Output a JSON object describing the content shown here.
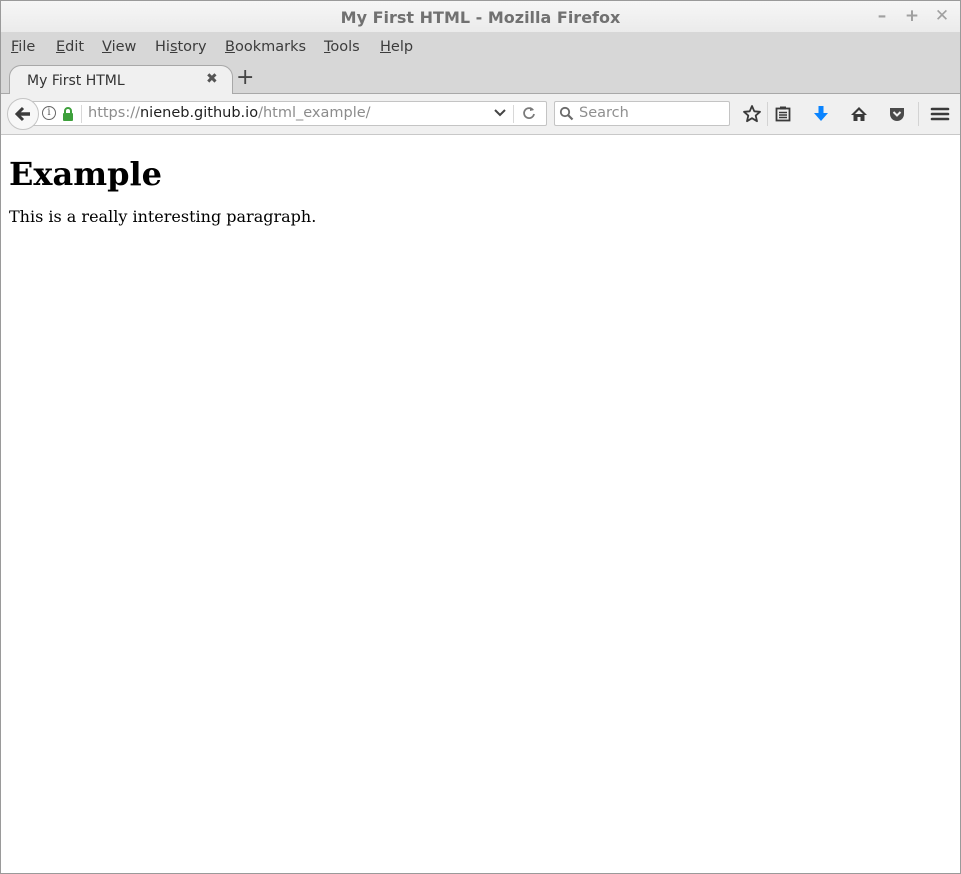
{
  "window": {
    "title": "My First HTML - Mozilla Firefox",
    "controls": {
      "minimize": "–",
      "maximize": "+",
      "close": "✕"
    }
  },
  "menubar": {
    "items": [
      {
        "label_pre": "",
        "accel": "F",
        "label_post": "ile"
      },
      {
        "label_pre": "",
        "accel": "E",
        "label_post": "dit"
      },
      {
        "label_pre": "",
        "accel": "V",
        "label_post": "iew"
      },
      {
        "label_pre": "Hi",
        "accel": "s",
        "label_post": "tory"
      },
      {
        "label_pre": "",
        "accel": "B",
        "label_post": "ookmarks"
      },
      {
        "label_pre": "",
        "accel": "T",
        "label_post": "ools"
      },
      {
        "label_pre": "",
        "accel": "H",
        "label_post": "elp"
      }
    ]
  },
  "tabs": {
    "active": {
      "title": "My First HTML",
      "close_glyph": "✖"
    },
    "new_tab_glyph": "+"
  },
  "navbar": {
    "url": {
      "scheme": "https://",
      "host": "nieneb.github.io",
      "path": "/html_example/"
    },
    "search": {
      "placeholder": "Search"
    },
    "icons": [
      "back-icon",
      "info-icon",
      "lock-icon",
      "dropdown-icon",
      "reload-icon",
      "search-icon",
      "bookmark-star-icon",
      "reading-list-icon",
      "download-icon",
      "home-icon",
      "pocket-icon",
      "menu-icon"
    ],
    "download_color": "#0a84ff",
    "lock_color": "#3ea03c"
  },
  "page": {
    "heading": "Example",
    "paragraph": "This is a really interesting paragraph."
  }
}
